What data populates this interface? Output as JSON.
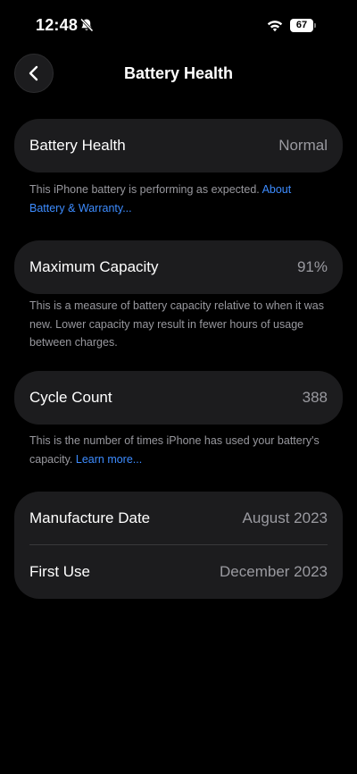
{
  "status_bar": {
    "time": "12:48",
    "battery_level": "67"
  },
  "nav": {
    "title": "Battery Health"
  },
  "battery_health": {
    "label": "Battery Health",
    "value": "Normal",
    "footnote_text": "This iPhone battery is performing as expected. ",
    "footnote_link": "About Battery & Warranty..."
  },
  "maximum_capacity": {
    "label": "Maximum Capacity",
    "value": "91%",
    "footnote_text": "This is a measure of battery capacity relative to when it was new. Lower capacity may result in fewer hours of usage between charges."
  },
  "cycle_count": {
    "label": "Cycle Count",
    "value": "388",
    "footnote_text": "This is the number of times iPhone has used your battery's capacity. ",
    "footnote_link": "Learn more..."
  },
  "dates": {
    "manufacture_label": "Manufacture Date",
    "manufacture_value": "August 2023",
    "first_use_label": "First Use",
    "first_use_value": "December 2023"
  }
}
